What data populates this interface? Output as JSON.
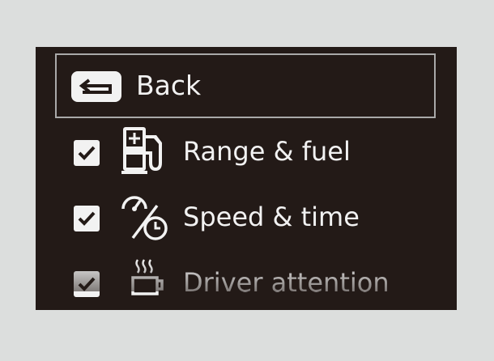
{
  "menu": {
    "back": {
      "label": "Back",
      "icon": "back-arrow-icon"
    },
    "items": [
      {
        "label": "Range & fuel",
        "checked": true,
        "icon": "fuel-pump-icon"
      },
      {
        "label": "Speed & time",
        "checked": true,
        "icon": "speed-time-icon"
      },
      {
        "label": "Driver attention",
        "checked": true,
        "icon": "coffee-cup-icon"
      }
    ]
  },
  "colors": {
    "screen_background": "#231a17",
    "page_background": "#dcdedd",
    "foreground": "#f2f2f2",
    "focus_border": "#a9a9a9"
  }
}
